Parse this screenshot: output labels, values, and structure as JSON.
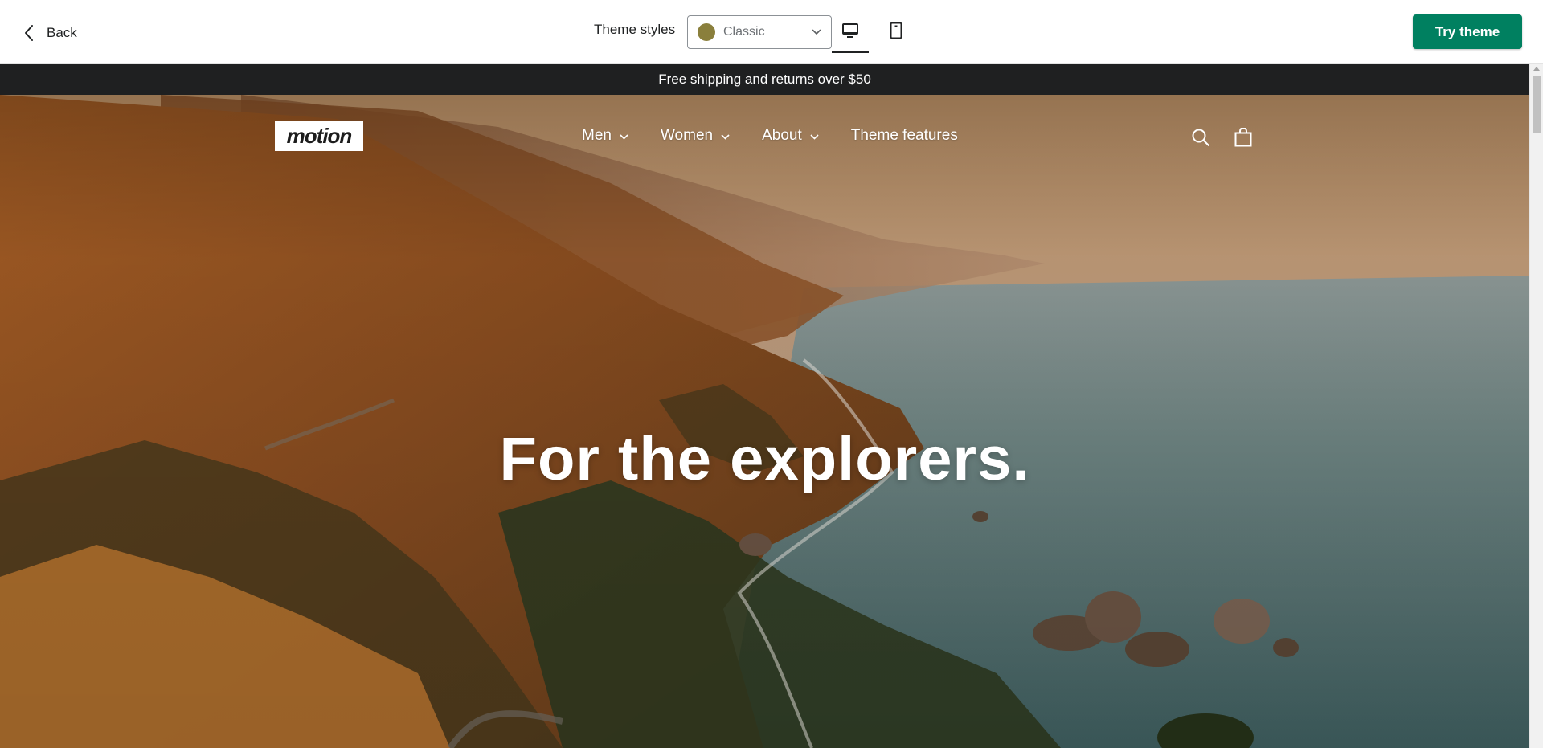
{
  "toolbar": {
    "back_label": "Back",
    "theme_styles_label": "Theme styles",
    "style_select": {
      "selected": "Classic",
      "swatch_color": "#8a7f3c"
    },
    "devices": [
      {
        "name": "desktop",
        "icon": "desktop-icon",
        "active": true
      },
      {
        "name": "mobile",
        "icon": "mobile-icon",
        "active": false
      }
    ],
    "try_theme_label": "Try theme",
    "try_theme_color": "#008060"
  },
  "store": {
    "announcement": "Free shipping and returns over $50",
    "announcement_bg": "#1f2021",
    "logo_text": "motion",
    "nav": [
      {
        "label": "Men",
        "has_dropdown": true
      },
      {
        "label": "Women",
        "has_dropdown": true
      },
      {
        "label": "About",
        "has_dropdown": true
      },
      {
        "label": "Theme features",
        "has_dropdown": false
      }
    ],
    "icons": [
      "search-icon",
      "cart-icon"
    ],
    "hero_headline": "For the explorers."
  }
}
